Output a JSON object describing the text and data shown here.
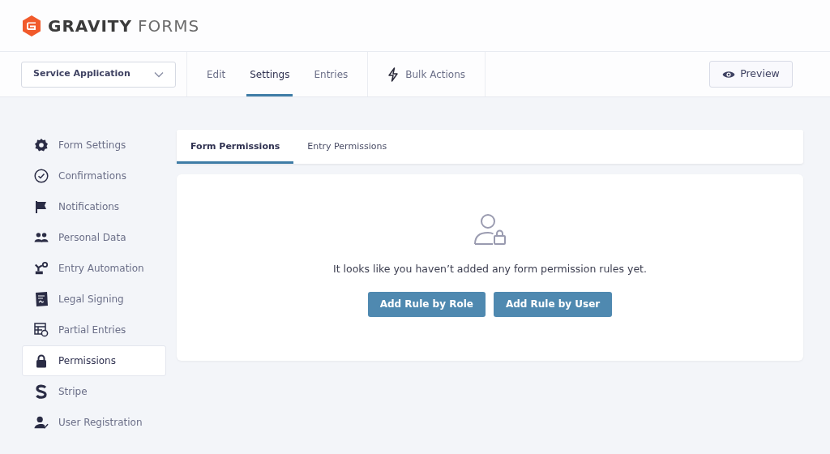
{
  "logo": {
    "brand": "GRAVITY",
    "product": "FORMS"
  },
  "form_selector": {
    "value": "Service Application"
  },
  "nav_tabs": [
    {
      "label": "Edit",
      "selected": false
    },
    {
      "label": "Settings",
      "selected": true
    },
    {
      "label": "Entries",
      "selected": false
    }
  ],
  "bulk_actions": "Bulk Actions",
  "preview_button": "Preview",
  "sidebar": {
    "items": [
      {
        "label": "Form Settings",
        "selected": false
      },
      {
        "label": "Confirmations",
        "selected": false
      },
      {
        "label": "Notifications",
        "selected": false
      },
      {
        "label": "Personal Data",
        "selected": false
      },
      {
        "label": "Entry Automation",
        "selected": false
      },
      {
        "label": "Legal Signing",
        "selected": false
      },
      {
        "label": "Partial Entries",
        "selected": false
      },
      {
        "label": "Permissions",
        "selected": true
      },
      {
        "label": "Stripe",
        "selected": false
      },
      {
        "label": "User Registration",
        "selected": false
      }
    ]
  },
  "content_tabs": [
    {
      "label": "Form Permissions",
      "selected": true
    },
    {
      "label": "Entry Permissions",
      "selected": false
    }
  ],
  "empty_state": {
    "message": "It looks like you haven’t added any form permission rules yet.",
    "buttons": [
      "Add Rule by Role",
      "Add Rule by User"
    ]
  }
}
